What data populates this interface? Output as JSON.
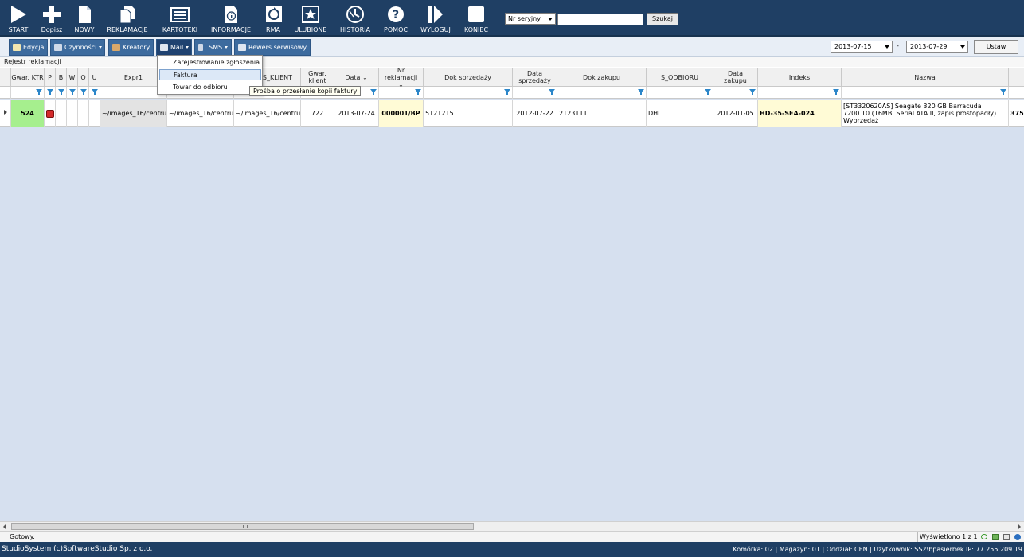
{
  "toolbar": {
    "buttons": [
      {
        "label": "START",
        "icon": "play-icon"
      },
      {
        "label": "Dopisz",
        "icon": "plus-icon"
      },
      {
        "label": "NOWY",
        "icon": "new-document-icon"
      },
      {
        "label": "REKLAMACJE",
        "icon": "documents-icon"
      },
      {
        "label": "KARTOTEKI",
        "icon": "card-index-icon"
      },
      {
        "label": "INFORMACJE",
        "icon": "info-document-icon"
      },
      {
        "label": "RMA",
        "icon": "rma-icon"
      },
      {
        "label": "ULUBIONE",
        "icon": "star-icon"
      },
      {
        "label": "HISTORIA",
        "icon": "history-icon"
      },
      {
        "label": "POMOC",
        "icon": "help-icon"
      },
      {
        "label": "WYLOGUJ",
        "icon": "logout-icon"
      },
      {
        "label": "KONIEC",
        "icon": "end-square-icon"
      }
    ],
    "search_type": "Nr seryjny",
    "search_value": "",
    "search_button": "Szukaj"
  },
  "actions": {
    "edycja": "Edycja",
    "czynnosci": "Czynności",
    "kreatory": "Kreatory",
    "mail": "Mail",
    "sms": "SMS",
    "rewers": "Rewers serwisowy",
    "date_from": "2013-07-15",
    "date_separator": "-",
    "date_to": "2013-07-29",
    "ustaw": "Ustaw"
  },
  "mail_menu": {
    "items": [
      "Zarejestrowanie zgłoszenia",
      "Faktura",
      "Towar do odbioru"
    ],
    "tooltip": "Prośba o przesłanie kopii faktury"
  },
  "grid": {
    "title": "Rejestr reklamacji",
    "columns": [
      "Gwar. KTR",
      "P",
      "B",
      "W",
      "O",
      "U",
      "Expr1",
      "",
      "S_KLIENT",
      "Gwar. klient",
      "Data ↓",
      "Nr reklamacji ↓",
      "Dok sprzedaży",
      "Data sprzedaży",
      "Dok zakupu",
      "S_ODBIORU",
      "Data zakupu",
      "Indeks",
      "Nazwa",
      ""
    ],
    "rows": [
      {
        "gwar_ktr": "524",
        "expr1": "~/images_16/centru",
        "col_hidden": "~/images_16/centru",
        "s_klient": "~/images_16/centru",
        "gwar_klient": "722",
        "data": "2013-07-24",
        "nr_reklamacji": "000001/BP",
        "dok_sprzedazy": "5121215",
        "data_sprzedazy": "2012-07-22",
        "dok_zakupu": "2123111",
        "s_odbioru": "DHL",
        "data_zakupu": "2012-01-05",
        "indeks": "HD-35-SEA-024",
        "nazwa_line1": "[ST3320620AS] Seagate 320 GB Barracuda",
        "nazwa_line2": "7200.10 (16MB, Serial ATA II, zapis prostopadły)",
        "nazwa_line3": "Wyprzedaż",
        "last": "375"
      }
    ]
  },
  "status": {
    "left": "Gotowy.",
    "right": "Wyświetlono 1 z 1"
  },
  "footer": {
    "left": "StudioSystem (c)SoftwareStudio Sp. z o.o.",
    "right": "Komórka: 02 | Magazyn: 01 | Oddział: CEN | Użytkownik: SS2\\bpasierbek IP: 77.255.209.19"
  },
  "colors": {
    "toolbar_bg": "#1f3f64",
    "button_bg": "#3d6b9e",
    "grid_bg": "#d6e0ef",
    "gwar_ktr_bg": "#a6ef8e",
    "status_red": "#d42a2a",
    "highlight_yellow": "#fffbd6"
  }
}
